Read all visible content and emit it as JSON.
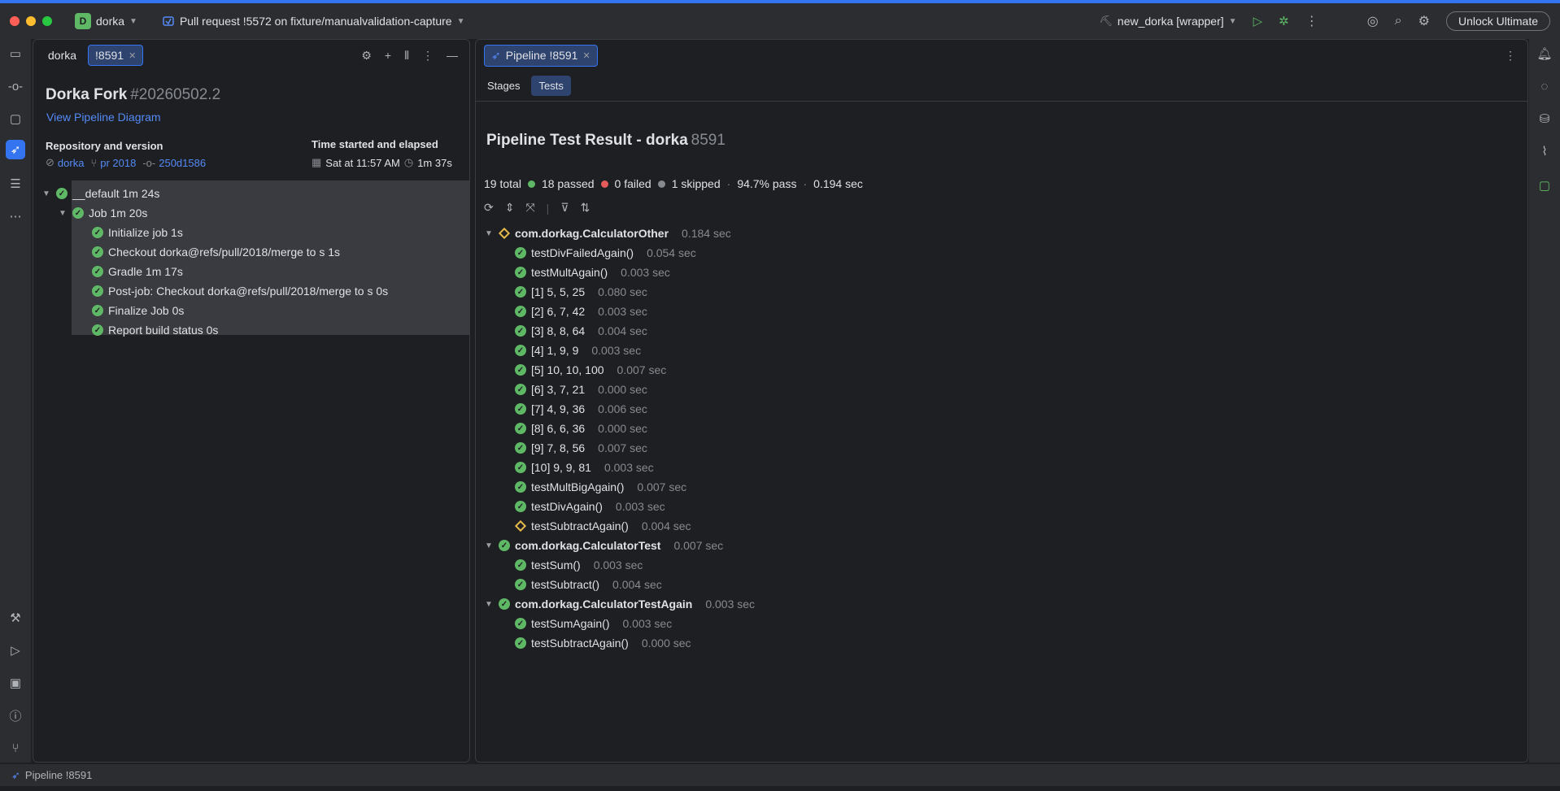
{
  "titlebar": {
    "project_initial": "D",
    "project_name": "dorka",
    "pr_title": "Pull request !5572 on fixture/manualvalidation-capture",
    "run_config": "new_dorka [wrapper]",
    "unlock_label": "Unlock Ultimate"
  },
  "left_panel": {
    "tabs": [
      {
        "label": "dorka"
      },
      {
        "label": "!8591"
      }
    ],
    "title_main": "Dorka Fork",
    "title_build": "#20260502.2",
    "diagram_link": "View Pipeline Diagram",
    "repo_heading": "Repository and version",
    "repo_name": "dorka",
    "pr_label": "pr 2018",
    "commit": "250d1586",
    "time_heading": "Time started and elapsed",
    "started": "Sat at 11:57 AM",
    "elapsed": "1m 37s",
    "tree": [
      {
        "label": "__default 1m 24s"
      },
      {
        "label": "Job 1m 20s"
      },
      {
        "label": "Initialize job 1s"
      },
      {
        "label": "Checkout dorka@refs/pull/2018/merge to s 1s"
      },
      {
        "label": "Gradle 1m 17s"
      },
      {
        "label": "Post-job: Checkout dorka@refs/pull/2018/merge to s 0s"
      },
      {
        "label": "Finalize Job 0s"
      },
      {
        "label": "Report build status 0s"
      }
    ]
  },
  "right_panel": {
    "tab_label": "Pipeline !8591",
    "subtabs": [
      {
        "label": "Stages"
      },
      {
        "label": "Tests"
      }
    ],
    "heading": "Pipeline Test Result - dorka",
    "heading_id": "8591",
    "summary": {
      "total": "19 total",
      "passed": "18 passed",
      "failed": "0 failed",
      "skipped": "1 skipped",
      "pass_rate": "94.7% pass",
      "duration": "0.194 sec"
    },
    "suites": [
      {
        "name": "com.dorkag.CalculatorOther",
        "duration": "0.184 sec",
        "status": "warn",
        "tests": [
          {
            "name": "testDivFailedAgain()",
            "duration": "0.054 sec",
            "status": "ok"
          },
          {
            "name": "testMultAgain()",
            "duration": "0.003 sec",
            "status": "ok"
          },
          {
            "name": "[1] 5, 5, 25",
            "duration": "0.080 sec",
            "status": "ok"
          },
          {
            "name": "[2] 6, 7, 42",
            "duration": "0.003 sec",
            "status": "ok"
          },
          {
            "name": "[3] 8, 8, 64",
            "duration": "0.004 sec",
            "status": "ok"
          },
          {
            "name": "[4] 1, 9, 9",
            "duration": "0.003 sec",
            "status": "ok"
          },
          {
            "name": "[5] 10, 10, 100",
            "duration": "0.007 sec",
            "status": "ok"
          },
          {
            "name": "[6] 3, 7, 21",
            "duration": "0.000 sec",
            "status": "ok"
          },
          {
            "name": "[7] 4, 9, 36",
            "duration": "0.006 sec",
            "status": "ok"
          },
          {
            "name": "[8] 6, 6, 36",
            "duration": "0.000 sec",
            "status": "ok"
          },
          {
            "name": "[9] 7, 8, 56",
            "duration": "0.007 sec",
            "status": "ok"
          },
          {
            "name": "[10] 9, 9, 81",
            "duration": "0.003 sec",
            "status": "ok"
          },
          {
            "name": "testMultBigAgain()",
            "duration": "0.007 sec",
            "status": "ok"
          },
          {
            "name": "testDivAgain()",
            "duration": "0.003 sec",
            "status": "ok"
          },
          {
            "name": "testSubtractAgain()",
            "duration": "0.004 sec",
            "status": "warn"
          }
        ]
      },
      {
        "name": "com.dorkag.CalculatorTest",
        "duration": "0.007 sec",
        "status": "ok",
        "tests": [
          {
            "name": "testSum()",
            "duration": "0.003 sec",
            "status": "ok"
          },
          {
            "name": "testSubtract()",
            "duration": "0.004 sec",
            "status": "ok"
          }
        ]
      },
      {
        "name": "com.dorkag.CalculatorTestAgain",
        "duration": "0.003 sec",
        "status": "ok",
        "tests": [
          {
            "name": "testSumAgain()",
            "duration": "0.003 sec",
            "status": "ok"
          },
          {
            "name": "testSubtractAgain()",
            "duration": "0.000 sec",
            "status": "ok"
          }
        ]
      }
    ]
  },
  "statusbar": {
    "label": "Pipeline !8591"
  },
  "colors": {
    "accent": "#3574f0",
    "passed": "#5fb865",
    "failed": "#e55b5b",
    "skipped": "#868a91",
    "warning": "#e5b84b"
  }
}
